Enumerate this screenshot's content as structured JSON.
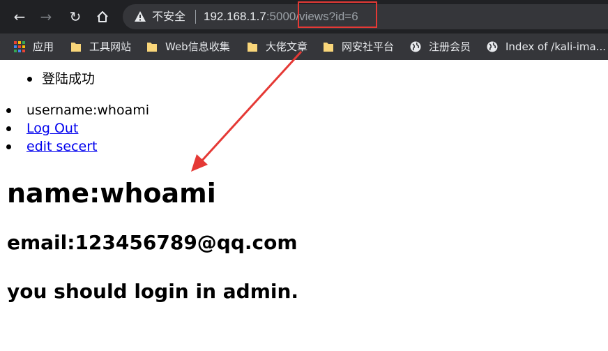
{
  "browser": {
    "security_label": "不安全",
    "url_host": "192.168.1.7",
    "url_rest": ":5000/views?id=6",
    "bookmarks": [
      {
        "label": "应用",
        "icon": "apps-grid-icon"
      },
      {
        "label": "工具网站",
        "icon": "folder-icon"
      },
      {
        "label": "Web信息收集",
        "icon": "folder-icon"
      },
      {
        "label": "大佬文章",
        "icon": "folder-icon"
      },
      {
        "label": "网安社平台",
        "icon": "folder-icon"
      },
      {
        "label": "注册会员",
        "icon": "globe-icon"
      },
      {
        "label": "Index of /kali-ima...",
        "icon": "globe-icon"
      }
    ]
  },
  "page": {
    "flash_message": "登陆成功",
    "nav": {
      "username": "username:whoami",
      "logout": "Log Out",
      "edit": "edit secert"
    },
    "heading_name": "name:whoami",
    "heading_email": "email:123456789@qq.com",
    "heading_note": "you should login in admin."
  },
  "colors": {
    "chrome_bg": "#202124",
    "bookmarks_bg": "#35363a",
    "annotation_red": "#e53935",
    "link_blue": "#0000ee"
  }
}
